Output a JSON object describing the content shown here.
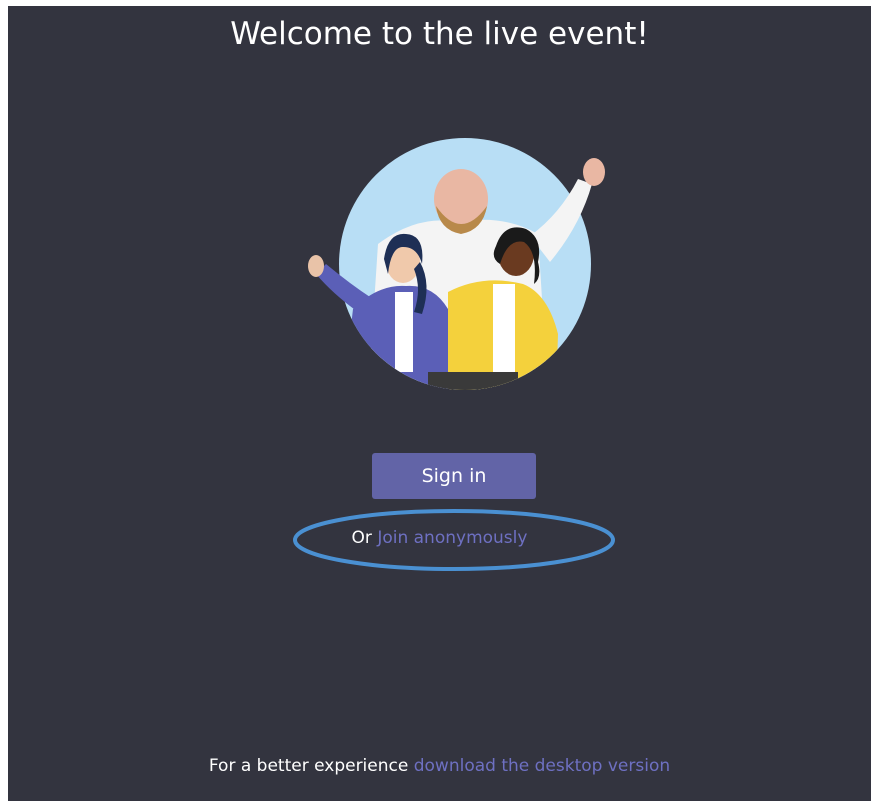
{
  "page": {
    "title": "Welcome to the live event!"
  },
  "signin": {
    "label": "Sign in"
  },
  "anonymous": {
    "prefix": "Or",
    "link_label": "Join anonymously"
  },
  "footer": {
    "prefix": "For a better experience",
    "link_label": "download the desktop version"
  },
  "colors": {
    "background": "#33343f",
    "accent": "#6264a7",
    "link": "#6e70c2",
    "highlight_ring": "#4a90d2"
  },
  "icons": {
    "illustration": "people-waving-illustration",
    "annotation": "highlight-ellipse"
  }
}
